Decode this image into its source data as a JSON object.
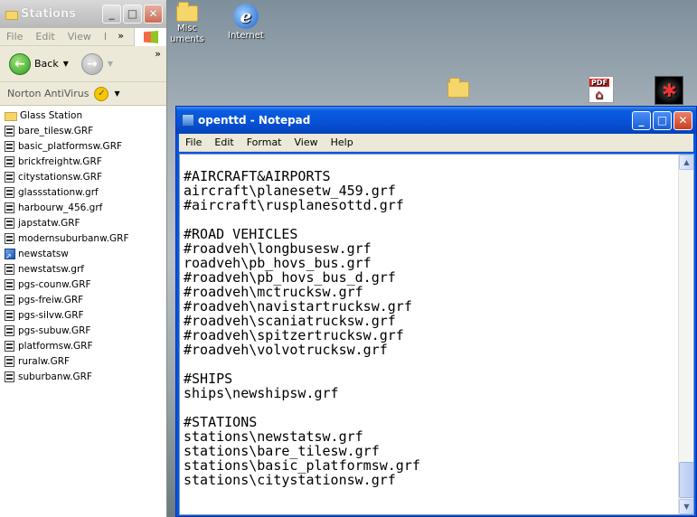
{
  "desktop": {
    "icons": [
      {
        "label": "Misc\numents"
      },
      {
        "label": "Internet"
      },
      {
        "label": ""
      },
      {
        "label": ""
      },
      {
        "label": ""
      }
    ],
    "adobe_badge": "Adobe"
  },
  "explorer": {
    "title": "Stations",
    "menu": [
      "File",
      "Edit",
      "View",
      "I"
    ],
    "toolbar": {
      "back_label": "Back"
    },
    "norton_label": "Norton AntiVirus",
    "files": [
      {
        "name": "Glass Station",
        "type": "folder"
      },
      {
        "name": "bare_tilesw.GRF",
        "type": "file"
      },
      {
        "name": "basic_platformsw.GRF",
        "type": "file"
      },
      {
        "name": "brickfreightw.GRF",
        "type": "file"
      },
      {
        "name": "citystationsw.GRF",
        "type": "file"
      },
      {
        "name": "glassstationw.grf",
        "type": "file"
      },
      {
        "name": "harbourw_456.grf",
        "type": "file"
      },
      {
        "name": "japstatw.GRF",
        "type": "file"
      },
      {
        "name": "modernsuburbanw.GRF",
        "type": "file"
      },
      {
        "name": "newstatsw",
        "type": "app"
      },
      {
        "name": "newstatsw.grf",
        "type": "file"
      },
      {
        "name": "pgs-counw.GRF",
        "type": "file"
      },
      {
        "name": "pgs-freiw.GRF",
        "type": "file"
      },
      {
        "name": "pgs-silvw.GRF",
        "type": "file"
      },
      {
        "name": "pgs-subuw.GRF",
        "type": "file"
      },
      {
        "name": "platformsw.GRF",
        "type": "file"
      },
      {
        "name": "ruralw.GRF",
        "type": "file"
      },
      {
        "name": "suburbanw.GRF",
        "type": "file"
      }
    ]
  },
  "notepad": {
    "title": "openttd - Notepad",
    "menu": [
      "File",
      "Edit",
      "Format",
      "View",
      "Help"
    ],
    "lines": [
      "#AIRCRAFT&AIRPORTS",
      "aircraft\\planesetw_459.grf",
      "#aircraft\\rusplanesottd.grf",
      "",
      "#ROAD VEHICLES",
      "#roadveh\\longbusesw.grf",
      "roadveh\\pb_hovs_bus.grf",
      "#roadveh\\pb_hovs_bus_d.grf",
      "#roadveh\\mctrucksw.grf",
      "#roadveh\\navistartrucksw.grf",
      "#roadveh\\scaniatrucksw.grf",
      "#roadveh\\spitzertrucksw.grf",
      "#roadveh\\volvotrucksw.grf",
      "",
      "#SHIPS",
      "ships\\newshipsw.grf",
      "",
      "#STATIONS",
      "stations\\newstatsw.grf",
      "stations\\bare_tilesw.grf",
      "stations\\basic_platformsw.grf",
      "stations\\citystationsw.grf"
    ]
  },
  "colors": {
    "xp_blue": "#0554e3",
    "menu_bg": "#ece9d8"
  }
}
